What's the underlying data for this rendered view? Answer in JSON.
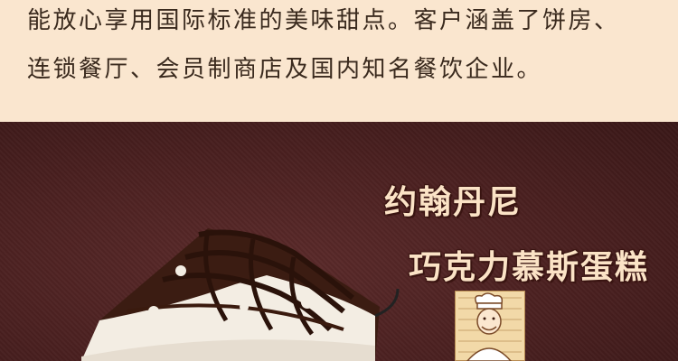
{
  "intro": {
    "line1": "能放心享用国际标准的美味甜点。客户涵盖了饼房、",
    "line2": "连锁餐厅、会员制商店及国内知名餐饮企业。"
  },
  "product": {
    "name_line1": "约翰丹尼",
    "name_line2": "巧克力慕斯蛋糕"
  },
  "colors": {
    "top_background": "#fae6cf",
    "bottom_background": "#4a2020",
    "title_text": "#fbe3c6"
  }
}
